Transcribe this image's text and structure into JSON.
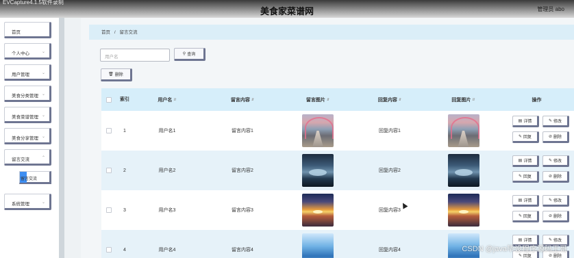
{
  "window": {
    "capture_title": "EVCapture4.1.5软件录制"
  },
  "header": {
    "site_title": "美食家菜谱网",
    "user_label": "管理员 abo"
  },
  "sidebar": {
    "items": [
      {
        "label": "首页"
      },
      {
        "label": "个人中心"
      },
      {
        "label": "用户管理"
      },
      {
        "label": "美食分类管理"
      },
      {
        "label": "美食菜谱管理"
      },
      {
        "label": "美食分享管理"
      },
      {
        "label": "留言交流"
      },
      {
        "label": "系统管理"
      }
    ],
    "subitem": {
      "label": "留言交流"
    }
  },
  "breadcrumb": {
    "home": "首页",
    "separator": "/",
    "current": "留言交流"
  },
  "search": {
    "placeholder": "用户名",
    "button_label": "查询",
    "button_icon": "search-icon"
  },
  "toolbar": {
    "delete_label": "删除",
    "delete_icon": "trash-icon"
  },
  "table": {
    "headers": {
      "index": "索引",
      "username": "用户名",
      "message": "留言内容",
      "message_image": "留言图片",
      "reply": "回复内容",
      "reply_image": "回复图片",
      "actions": "操作"
    },
    "rows": [
      {
        "index": "1",
        "username": "用户名1",
        "message": "留言内容1",
        "reply": "回复内容1",
        "image": "rainbow"
      },
      {
        "index": "2",
        "username": "用户名2",
        "message": "留言内容2",
        "reply": "回复内容2",
        "image": "river"
      },
      {
        "index": "3",
        "username": "用户名3",
        "message": "留言内容3",
        "reply": "回复内容3",
        "image": "sunset"
      },
      {
        "index": "4",
        "username": "用户名4",
        "message": "留言内容4",
        "reply": "回复内容4",
        "image": "sky"
      }
    ],
    "actions": {
      "detail": "详情",
      "edit": "修改",
      "reply": "回复",
      "delete": "删除"
    }
  },
  "watermark": "CSDN @java毕设程序源码王哥",
  "colors": {
    "accent": "#3d8ef2",
    "header_bg": "#d6eefa",
    "button_border": "#6e7591"
  }
}
